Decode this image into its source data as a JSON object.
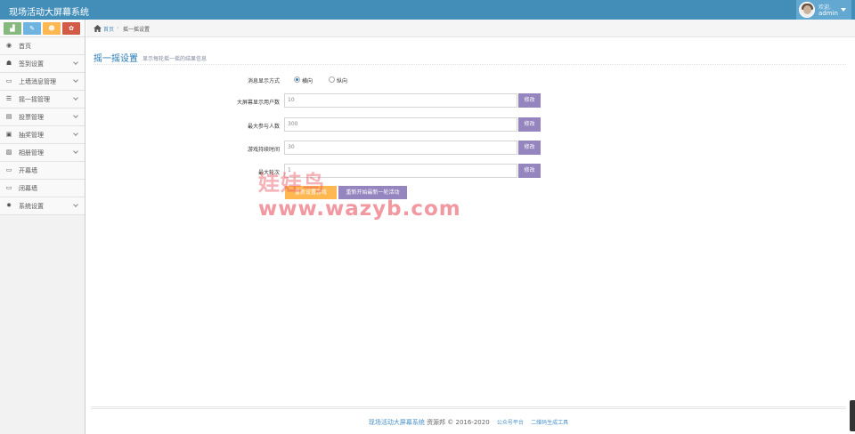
{
  "app": {
    "title": "现场活动大屏幕系统"
  },
  "user": {
    "welcome": "欢迎,",
    "name": "admin"
  },
  "shortcuts": [
    {
      "icon": "signal-icon",
      "glyph": "▟"
    },
    {
      "icon": "pencil-icon",
      "glyph": "✎"
    },
    {
      "icon": "users-icon",
      "glyph": "☻"
    },
    {
      "icon": "cogs-icon",
      "glyph": "✿"
    }
  ],
  "sidebar": {
    "items": [
      {
        "label": "首页",
        "icon": "dashboard-icon",
        "glyph": "◉",
        "has_sub": false
      },
      {
        "label": "签到设置",
        "icon": "users-icon",
        "glyph": "☗",
        "has_sub": true
      },
      {
        "label": "上墙消息管理",
        "icon": "desktop-icon",
        "glyph": "▭",
        "has_sub": true
      },
      {
        "label": "摇一摇管理",
        "icon": "list-icon",
        "glyph": "☰",
        "has_sub": true
      },
      {
        "label": "投票管理",
        "icon": "list-alt-icon",
        "glyph": "▤",
        "has_sub": true
      },
      {
        "label": "抽奖管理",
        "icon": "gift-icon",
        "glyph": "▣",
        "has_sub": true
      },
      {
        "label": "相册管理",
        "icon": "picture-icon",
        "glyph": "▨",
        "has_sub": true
      },
      {
        "label": "开幕墙",
        "icon": "desktop-icon",
        "glyph": "▭",
        "has_sub": false
      },
      {
        "label": "闭幕墙",
        "icon": "desktop-icon",
        "glyph": "▭",
        "has_sub": false
      },
      {
        "label": "系统设置",
        "icon": "cog-icon",
        "glyph": "✹",
        "has_sub": true
      }
    ]
  },
  "breadcrumb": {
    "home": "首页",
    "separator": "›",
    "current": "摇一摇设置"
  },
  "page": {
    "title": "摇一摇设置",
    "subtitle": "显示每轮摇一摇的结果信息"
  },
  "form": {
    "display_mode": {
      "label": "消息显示方式",
      "options": [
        "横向",
        "纵向"
      ],
      "selected": 0
    },
    "fields": [
      {
        "label": "大屏幕显示用户数",
        "value": "10",
        "button": "修改"
      },
      {
        "label": "最大参与人数",
        "value": "300",
        "button": "修改"
      },
      {
        "label": "游戏持续时间",
        "value": "30",
        "button": "修改"
      },
      {
        "label": "最大轮次",
        "value": "1",
        "button": "修改"
      }
    ],
    "reset_game_button": "重新设置游戏",
    "restart_round_button": "重新开始最新一轮活动"
  },
  "watermark": {
    "line1": "娃娃鸟",
    "line2": "www.wazyb.com"
  },
  "footer": {
    "brand": "现场活动大屏幕系统",
    "copyright": "资源邦 © 2016-2020",
    "links": [
      "公众号平台",
      "二维码生成工具"
    ]
  },
  "colors": {
    "navbar": "#438eb9",
    "primary_link": "#478fca",
    "button_purple": "#9585bf",
    "button_orange": "#ffb752"
  }
}
